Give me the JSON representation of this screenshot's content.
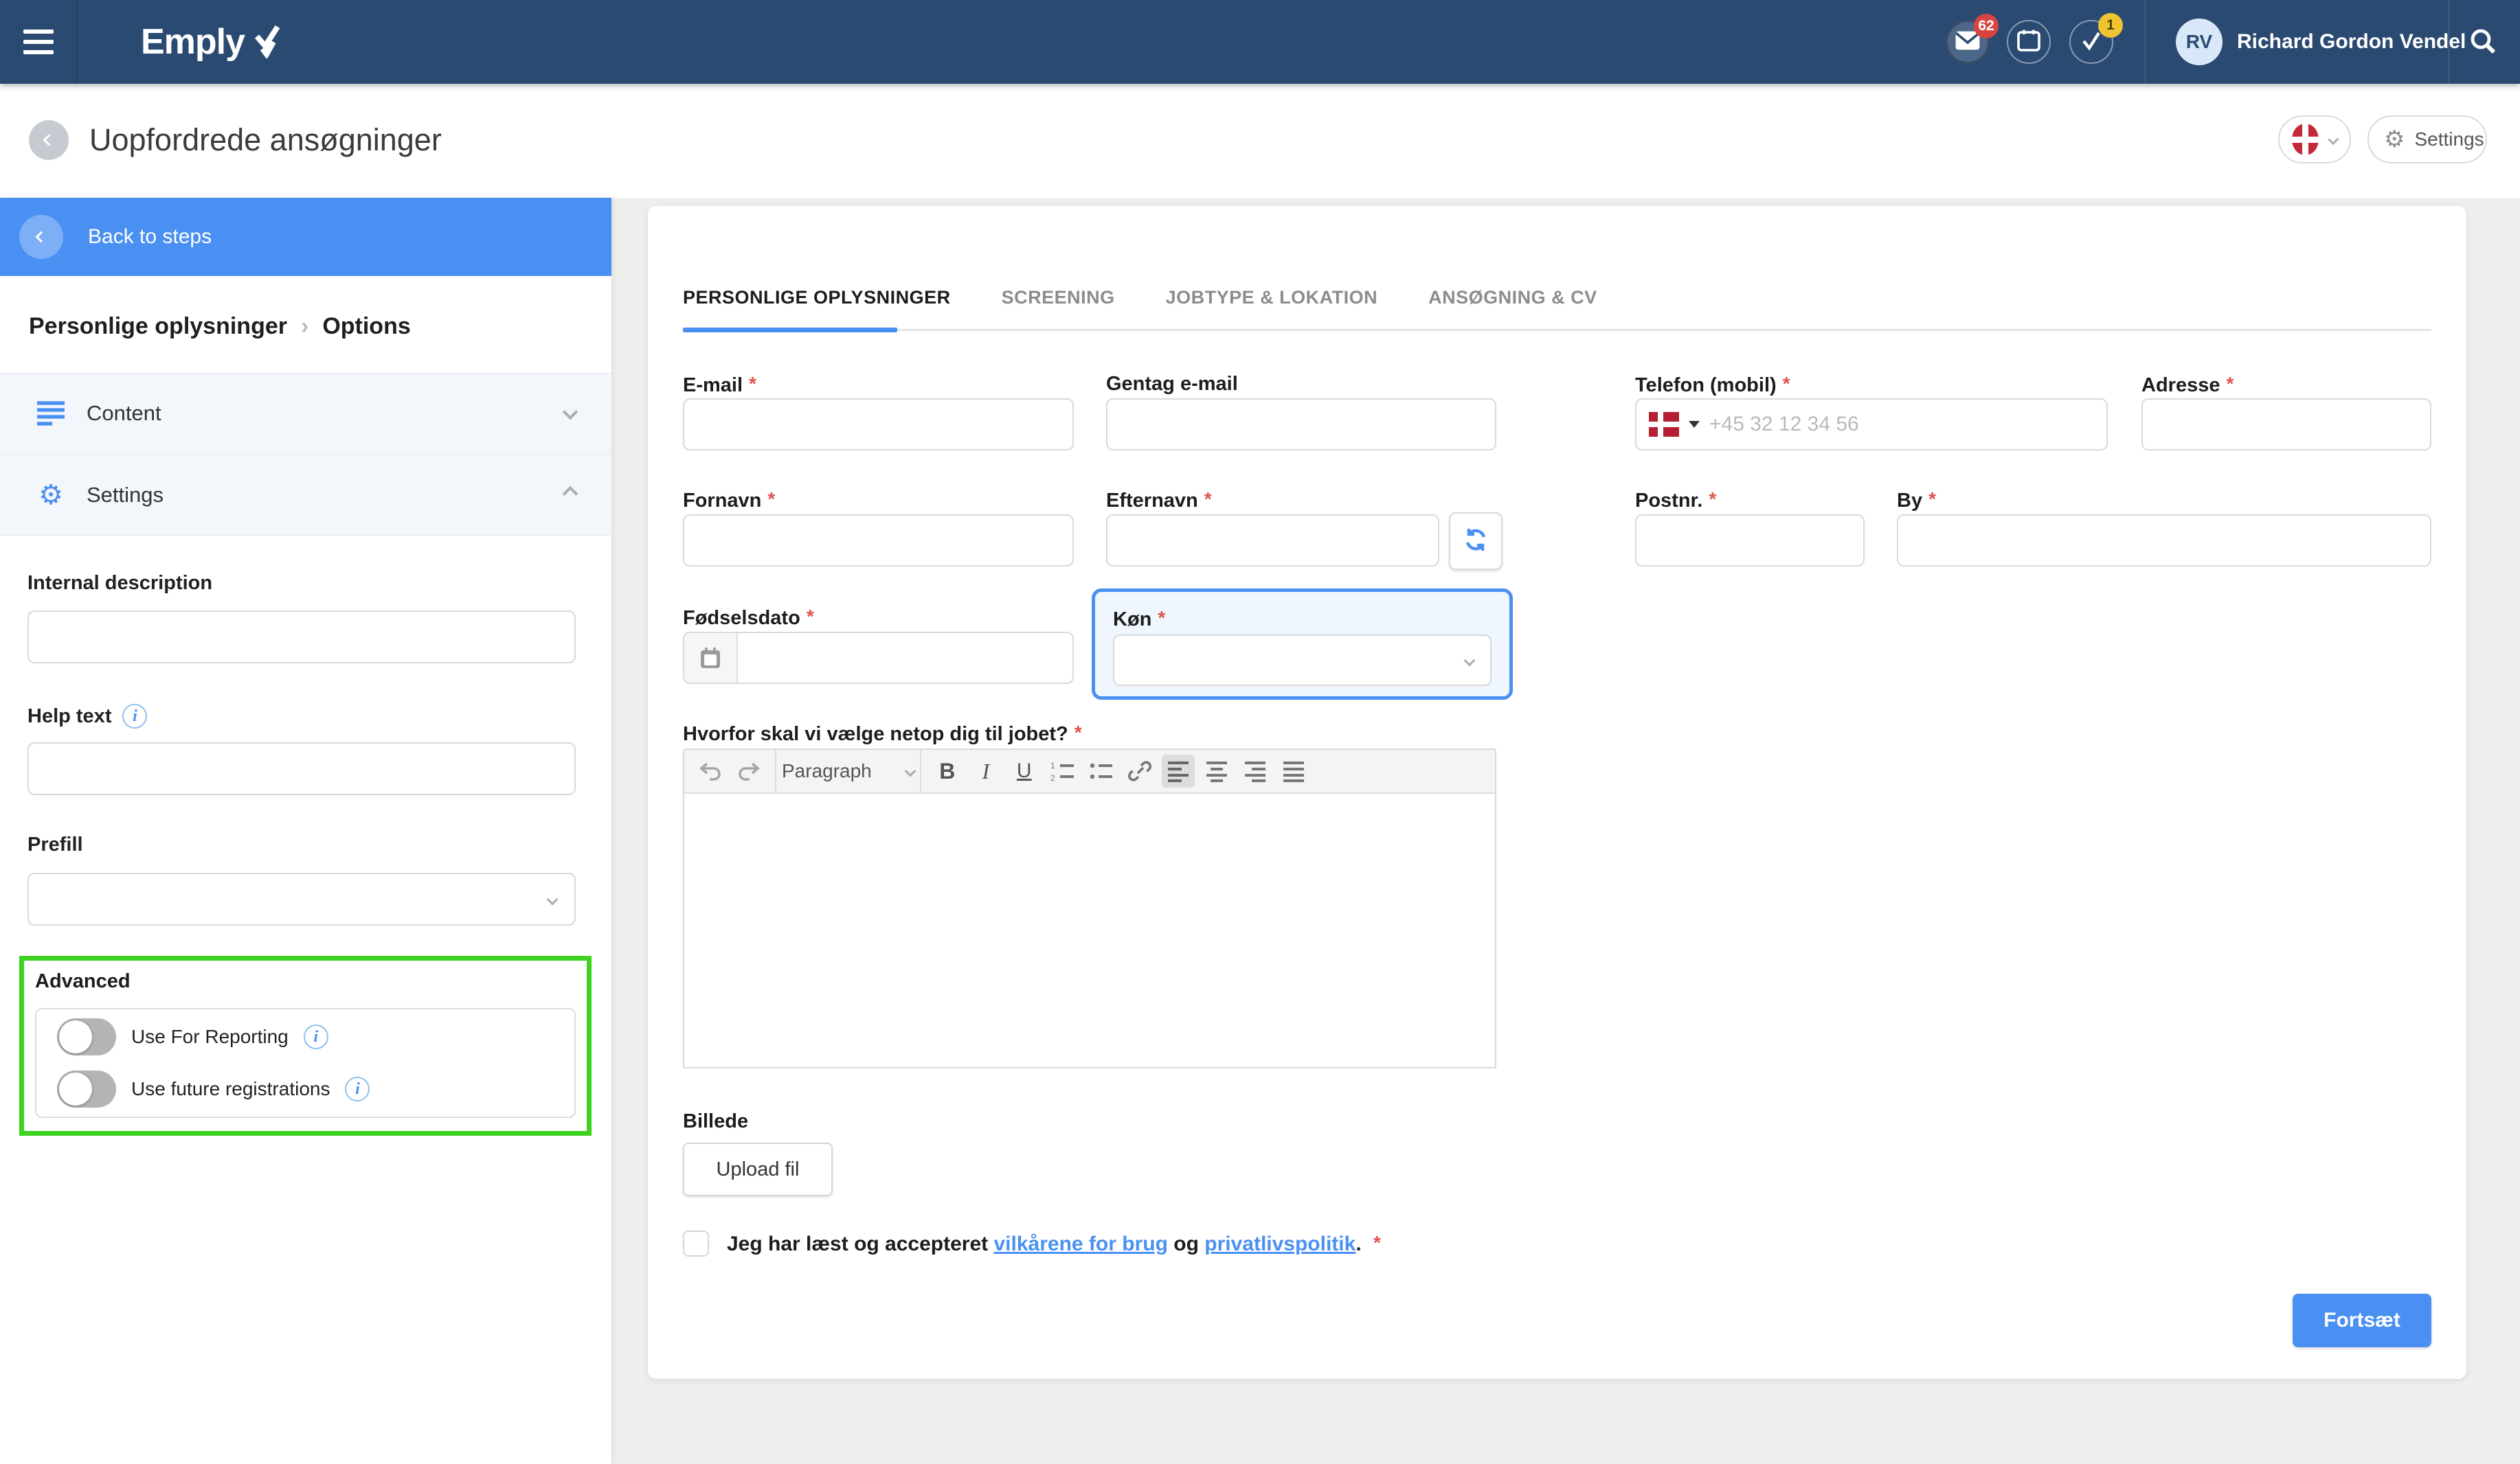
{
  "colors": {
    "navbar_blue": "#2b4a72",
    "accent_blue": "#4a90f2",
    "highlight_green": "#3ed321",
    "required_red": "#e0544c",
    "link_blue": "#4a90f2"
  },
  "navbar": {
    "logo_text": "Emply",
    "mail_badge": "62",
    "tasks_badge": "1",
    "user_initials": "RV",
    "user_name": "Richard Gordon Vendel"
  },
  "header": {
    "title": "Uopfordrede ansøgninger",
    "settings_label": "Settings"
  },
  "sidebar": {
    "back_to_steps_label": "Back to steps",
    "breadcrumb": {
      "parent": "Personlige oplysninger",
      "separator": "›",
      "current": "Options"
    },
    "content_section_label": "Content",
    "settings_section_label": "Settings",
    "internal_description_label": "Internal description",
    "help_text_label": "Help text",
    "prefill_label": "Prefill",
    "advanced_label": "Advanced",
    "toggles": [
      {
        "label": "Use For Reporting",
        "state": "off"
      },
      {
        "label": "Use future registrations",
        "state": "off"
      }
    ]
  },
  "form": {
    "required_marker": "*",
    "tabs": [
      {
        "label": "PERSONLIGE OPLYSNINGER",
        "active": true
      },
      {
        "label": "SCREENING",
        "active": false
      },
      {
        "label": "JOBTYPE & LOKATION",
        "active": false
      },
      {
        "label": "ANSØGNING & CV",
        "active": false
      }
    ],
    "email_label": "E-mail",
    "repeat_email_label": "Gentag e-mail",
    "phone_label": "Telefon (mobil)",
    "phone_placeholder": "+45 32 12 34 56",
    "address_label": "Adresse",
    "firstname_label": "Fornavn",
    "lastname_label": "Efternavn",
    "zip_label": "Postnr.",
    "city_label": "By",
    "birthdate_label": "Fødselsdato",
    "gender_label": "Køn",
    "motivation_label": "Hvorfor skal vi vælge netop dig til jobet?",
    "editor_paragraph_label": "Paragraph",
    "image_label": "Billede",
    "upload_label": "Upload fil",
    "terms_prefix": "Jeg har læst og accepteret",
    "terms_link_1": "vilkårene for brug",
    "terms_and": "og",
    "terms_link_2": "privatlivspolitik",
    "terms_suffix": ".",
    "submit_label": "Fortsæt"
  }
}
